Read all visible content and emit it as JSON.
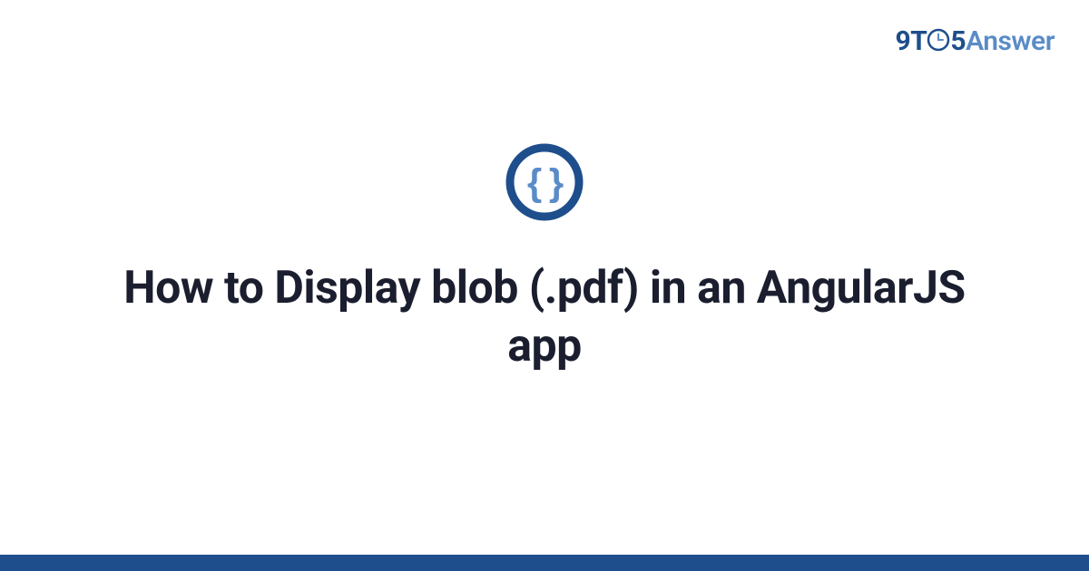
{
  "brand": {
    "part1": "9T",
    "part2": "5",
    "part3": "Answer"
  },
  "title": "How to Display blob (.pdf) in an AngularJS app",
  "colors": {
    "brand_dark": "#1e4e8c",
    "brand_light": "#5a8cc7",
    "text": "#1a1e2e",
    "icon_ring": "#1e4e8c",
    "icon_braces": "#5a8cc7"
  }
}
